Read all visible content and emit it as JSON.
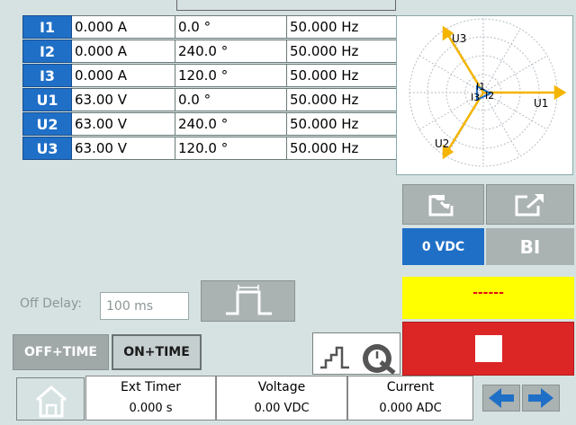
{
  "channels": [
    {
      "label": "I1",
      "magnitude": "0.000 A",
      "phase": "0.0 °",
      "frequency": "50.000 Hz"
    },
    {
      "label": "I2",
      "magnitude": "0.000 A",
      "phase": "240.0 °",
      "frequency": "50.000 Hz"
    },
    {
      "label": "I3",
      "magnitude": "0.000 A",
      "phase": "120.0 °",
      "frequency": "50.000 Hz"
    },
    {
      "label": "U1",
      "magnitude": "63.00 V",
      "phase": "0.0 °",
      "frequency": "50.000 Hz"
    },
    {
      "label": "U2",
      "magnitude": "63.00 V",
      "phase": "240.0 °",
      "frequency": "50.000 Hz"
    },
    {
      "label": "U3",
      "magnitude": "63.00 V",
      "phase": "120.0 °",
      "frequency": "50.000 Hz"
    }
  ],
  "vector_diagram": {
    "labels": {
      "u1": "U1",
      "u2": "U2",
      "u3": "U3",
      "i1": "I1",
      "i2": "I2",
      "i3": "I3"
    },
    "voltage_color": "#f4b400",
    "current_color": "#1f6fc7"
  },
  "controls": {
    "vdc_button": "0 VDC",
    "bi_button": "BI",
    "off_delay_label": "Off Delay:",
    "off_delay_value": "100 ms",
    "mode_off_time": "OFF+TIME",
    "mode_on_time": "ON+TIME",
    "status_text": "------"
  },
  "footer": {
    "ext_timer_title": "Ext Timer",
    "ext_timer_value": "0.000 s",
    "voltage_title": "Voltage",
    "voltage_value": "0.00 VDC",
    "current_title": "Current",
    "current_value": "0.000 ADC"
  },
  "colors": {
    "accent_blue": "#1f6fc7",
    "status_yellow": "#ffff00",
    "stop_red": "#dc2626",
    "background": "#d6e2e2"
  }
}
